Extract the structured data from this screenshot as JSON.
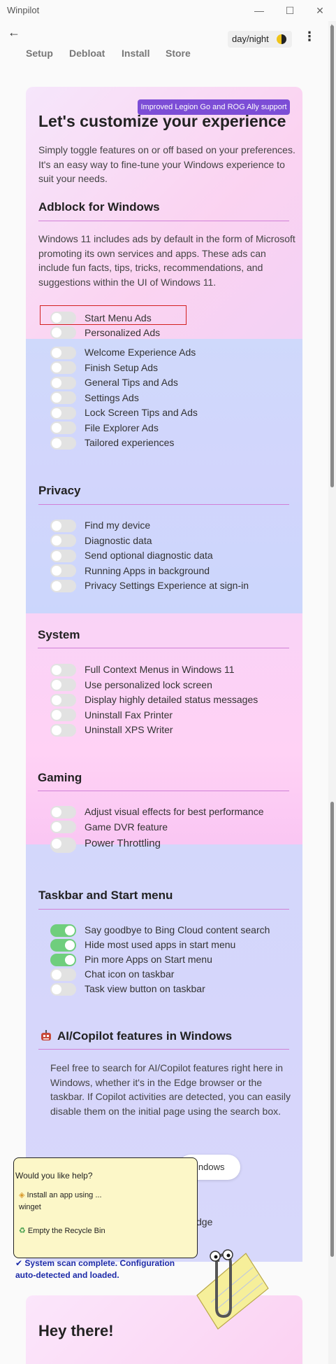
{
  "window": {
    "title": "Winpilot",
    "minimize": "—",
    "maximize": "☐",
    "close": "✕"
  },
  "header": {
    "back_icon": "←",
    "daynight_label": "day/night",
    "menu_icon": "⋮"
  },
  "nav": [
    "Setup",
    "Debloat",
    "Install",
    "Store"
  ],
  "hero": {
    "badge": "Improved Legion Go and ROG Ally support",
    "title": "Let's customize your experience",
    "intro": "Simply toggle features on or off based on your preferences. It's an easy way to fine-tune your Windows experience to suit your needs."
  },
  "adblock": {
    "title": "Adblock for Windows",
    "description": "Windows 11 includes ads by default in the form of Microsoft promoting its own services and apps. These ads can include fun facts, tips, tricks, recommendations, and suggestions within the UI of Windows 11.",
    "items": [
      {
        "label": "Start Menu Ads",
        "on": false
      },
      {
        "label": "Personalized Ads",
        "on": false
      },
      {
        "label": "Welcome Experience Ads",
        "on": false
      },
      {
        "label": "Finish Setup Ads",
        "on": false
      },
      {
        "label": "General Tips and Ads",
        "on": false
      },
      {
        "label": "Settings Ads",
        "on": false
      },
      {
        "label": "Lock Screen Tips and Ads",
        "on": false
      },
      {
        "label": "File Explorer Ads",
        "on": false
      },
      {
        "label": "Tailored experiences",
        "on": false
      }
    ]
  },
  "privacy": {
    "title": "Privacy",
    "items": [
      {
        "label": "Find my device",
        "on": false
      },
      {
        "label": "Diagnostic data",
        "on": false
      },
      {
        "label": "Send optional diagnostic data",
        "on": false
      },
      {
        "label": "Running Apps in background",
        "on": false
      },
      {
        "label": "Privacy Settings Experience at sign-in",
        "on": false
      }
    ]
  },
  "system": {
    "title": "System",
    "items": [
      {
        "label": "Full Context Menus in Windows 11",
        "on": false
      },
      {
        "label": "Use personalized lock screen",
        "on": false
      },
      {
        "label": "Display highly detailed status messages",
        "on": false
      },
      {
        "label": "Uninstall Fax Printer",
        "on": false
      },
      {
        "label": "Uninstall XPS Writer",
        "on": false
      }
    ]
  },
  "gaming": {
    "title": "Gaming",
    "items": [
      {
        "label": "Adjust visual effects for best performance",
        "on": false
      },
      {
        "label": "Game DVR feature",
        "on": false
      },
      {
        "label": "Power Throttling",
        "on": false
      }
    ]
  },
  "taskbar": {
    "title": "Taskbar and Start menu",
    "items": [
      {
        "label": "Say goodbye to Bing Cloud content search",
        "on": true
      },
      {
        "label": "Hide most used apps in start menu",
        "on": true
      },
      {
        "label": "Pin more Apps on Start menu",
        "on": true
      },
      {
        "label": "Chat icon on taskbar",
        "on": false
      },
      {
        "label": "Task view button on taskbar",
        "on": false
      }
    ]
  },
  "ai": {
    "title": "AI/Copilot features in Windows",
    "icon": "robot-icon",
    "description": "Feel free to search for AI/Copilot features right here in Windows, whether it's in the Edge browser or the taskbar. If Copilot activities are detected, you can easily disable them on the initial page using the search box.",
    "search_fragment": "indows",
    "edge_fragment": "dge"
  },
  "assistant": {
    "question": "Would you like help?",
    "option1": "Install an app using ... winget",
    "option2": "Empty the Recycle Bin",
    "status": "System scan complete. Configuration auto-detected and loaded."
  },
  "footer": {
    "title": "Hey there!"
  }
}
